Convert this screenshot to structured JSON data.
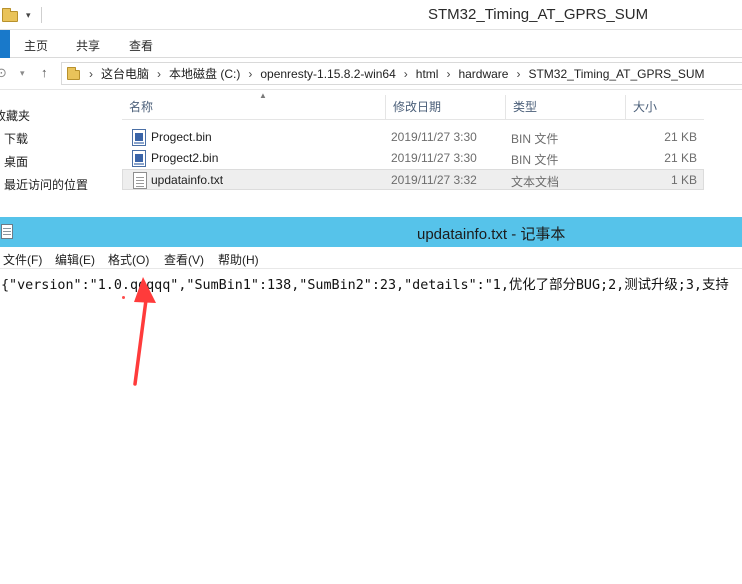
{
  "explorer": {
    "title": "STM32_Timing_AT_GPRS_SUM",
    "ribbon_tabs": [
      "主页",
      "共享",
      "查看"
    ],
    "breadcrumb": [
      "这台电脑",
      "本地磁盘 (C:)",
      "openresty-1.15.8.2-win64",
      "html",
      "hardware",
      "STM32_Timing_AT_GPRS_SUM"
    ],
    "nav_items": [
      "收藏夹",
      "下载",
      "桌面",
      "最近访问的位置"
    ],
    "columns": {
      "name": "名称",
      "date": "修改日期",
      "type": "类型",
      "size": "大小"
    },
    "files": [
      {
        "name": "Progect.bin",
        "date": "2019/11/27 3:30",
        "type": "BIN 文件",
        "size": "21 KB",
        "icon": "bin-file-icon"
      },
      {
        "name": "Progect2.bin",
        "date": "2019/11/27 3:30",
        "type": "BIN 文件",
        "size": "21 KB",
        "icon": "bin-file-icon"
      },
      {
        "name": "updatainfo.txt",
        "date": "2019/11/27 3:32",
        "type": "文本文档",
        "size": "1 KB",
        "icon": "text-file-icon",
        "selected": true
      }
    ]
  },
  "notepad": {
    "title": "updatainfo.txt - 记事本",
    "menu": [
      "文件(F)",
      "编辑(E)",
      "格式(O)",
      "查看(V)",
      "帮助(H)"
    ],
    "content": "{\"version\":\"1.0.qqqqq\",\"SumBin1\":138,\"SumBin2\":23,\"details\":\"1,优化了部分BUG;2,测试升级;3,支持"
  },
  "colors": {
    "notepad_titlebar": "#56c3ea",
    "explorer_file_tab": "#1979ca",
    "annotation": "#ff3b3b",
    "folder": "#e9c35a"
  }
}
